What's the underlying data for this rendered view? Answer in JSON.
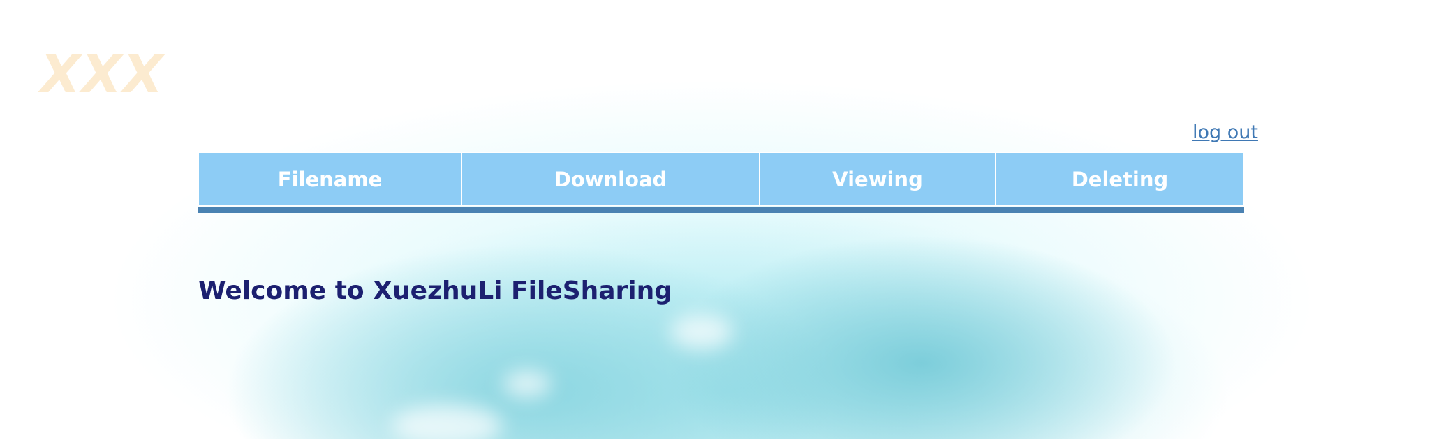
{
  "logo": {
    "text": "XXX"
  },
  "header": {
    "logout_label": "log out"
  },
  "nav": {
    "items": [
      {
        "label": "Filename"
      },
      {
        "label": "Download"
      },
      {
        "label": "Viewing"
      },
      {
        "label": "Deleting"
      }
    ]
  },
  "main": {
    "welcome": "Welcome to XuezhuLi FileSharing"
  },
  "colors": {
    "nav_background": "#8dccf5",
    "nav_underline": "#4a82b2",
    "welcome_text": "#1c2070",
    "logo_text": "#fcebd0",
    "link": "#3f78b4"
  }
}
